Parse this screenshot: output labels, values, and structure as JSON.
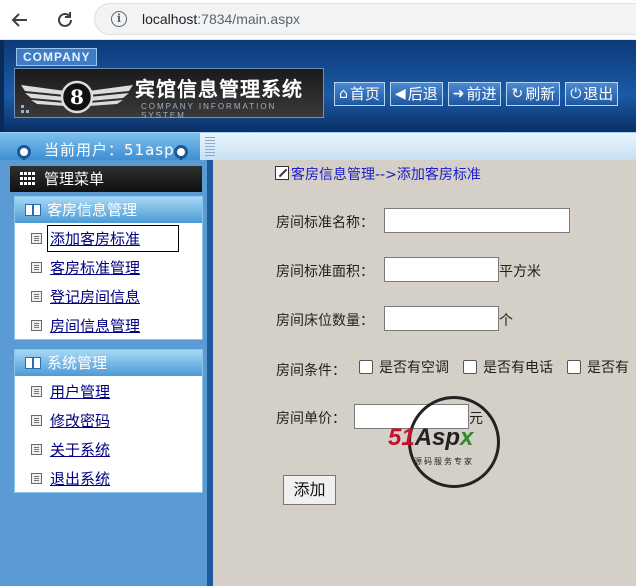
{
  "browser": {
    "url_host": "localhost",
    "url_rest": ":7834/main.aspx"
  },
  "banner": {
    "company_tag": "COMPANY",
    "title": "宾馆信息管理系统",
    "subtitle": "COMPANY INFORMATION SYSTEM",
    "nav": [
      {
        "label": "首页",
        "icon": "home-icon"
      },
      {
        "label": "后退",
        "icon": "back-arrow-icon"
      },
      {
        "label": "前进",
        "icon": "forward-arrow-icon"
      },
      {
        "label": "刷新",
        "icon": "refresh-icon"
      },
      {
        "label": "退出",
        "icon": "power-icon"
      }
    ]
  },
  "user": {
    "line": "当前用户：51aspx"
  },
  "sidebar": {
    "menu_title": "管理菜单",
    "groups": [
      {
        "title": "客房信息管理",
        "items": [
          "添加客房标准",
          "客房标准管理",
          "登记房间信息",
          "房间信息管理"
        ]
      },
      {
        "title": "系统管理",
        "items": [
          "用户管理",
          "修改密码",
          "关于系统",
          "退出系统"
        ]
      }
    ]
  },
  "content": {
    "breadcrumb": "客房信息管理-->添加客房标准",
    "form": {
      "name_label": "房间标准名称：",
      "area_label": "房间标准面积：",
      "area_unit": "平方米",
      "beds_label": "房间床位数量：",
      "beds_unit": "个",
      "conditions_label": "房间条件：",
      "conditions": [
        "是否有空调",
        "是否有电话",
        "是否有"
      ],
      "price_label": "房间单价：",
      "price_unit": "元",
      "submit_label": "添加"
    },
    "watermark": {
      "brand_red": "51",
      "brand_dark": "Asp",
      "brand_green": "x",
      "tagline": "源码服务专家"
    }
  }
}
